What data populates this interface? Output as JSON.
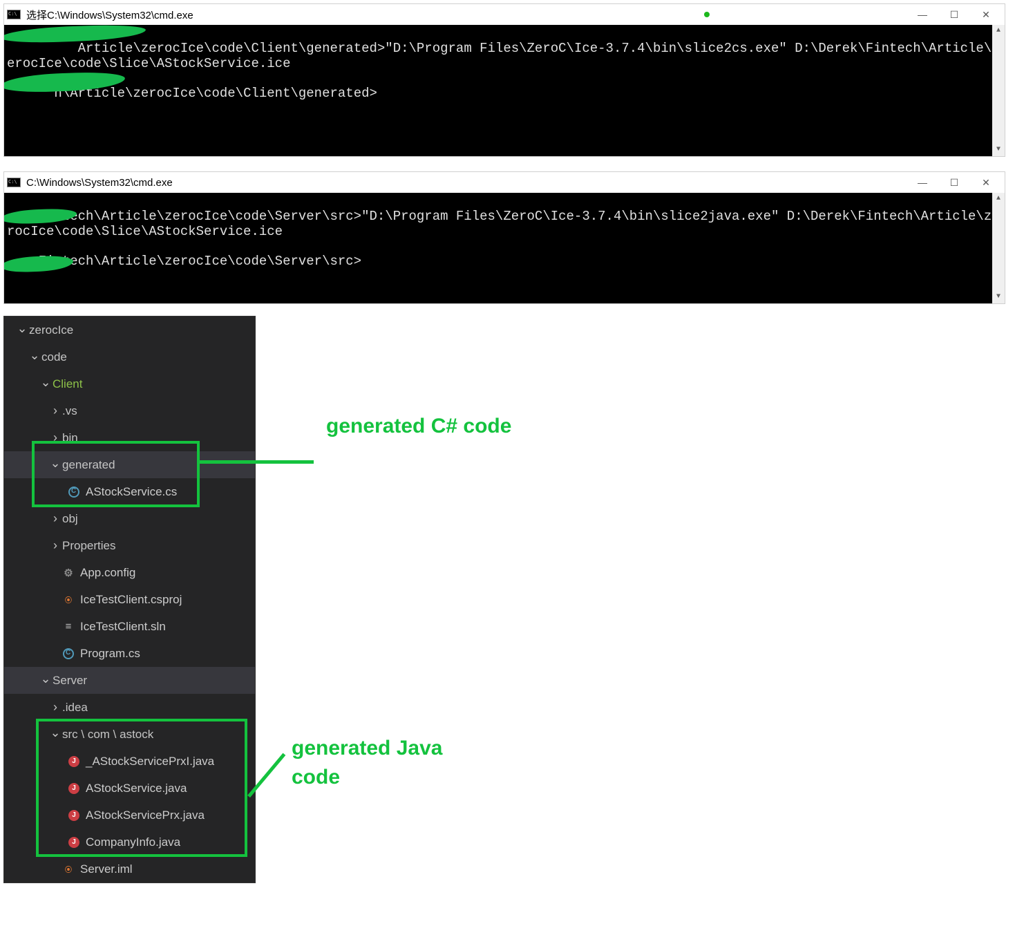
{
  "cmd1": {
    "title": "选择C:\\Windows\\System32\\cmd.exe",
    "line1_pre": "         Article\\zerocIce\\code\\Client\\generated>\"D:\\Program Files\\ZeroC\\Ice-3.7.4\\bin\\slice2cs.exe\" D:\\Derek\\Fintech\\Article\\zerocIce\\code\\Slice\\AStockService.ice",
    "line2": "      h\\Article\\zerocIce\\code\\Client\\generated>"
  },
  "cmd2": {
    "title": "C:\\Windows\\System32\\cmd.exe",
    "line1": "    Fintech\\Article\\zerocIce\\code\\Server\\src>\"D:\\Program Files\\ZeroC\\Ice-3.7.4\\bin\\slice2java.exe\" D:\\Derek\\Fintech\\Article\\zerocIce\\code\\Slice\\AStockService.ice",
    "line2": "    Fintech\\Article\\zerocIce\\code\\Server\\src>"
  },
  "tree": {
    "root": "zerocIce",
    "code": "code",
    "client": "Client",
    "vs": ".vs",
    "bin": "bin",
    "generated": "generated",
    "astock_cs": "AStockService.cs",
    "obj": "obj",
    "properties": "Properties",
    "appconfig": "App.config",
    "csproj": "IceTestClient.csproj",
    "sln": "IceTestClient.sln",
    "program": "Program.cs",
    "server": "Server",
    "idea": ".idea",
    "srcpath": "src \\ com \\ astock",
    "j1": "_AStockServicePrxI.java",
    "j2": "AStockService.java",
    "j3": "AStockServicePrx.java",
    "j4": "CompanyInfo.java",
    "iml": "Server.iml"
  },
  "anno": {
    "cs_label": "generated C# code",
    "java_label1": "generated Java",
    "java_label2": "code"
  }
}
